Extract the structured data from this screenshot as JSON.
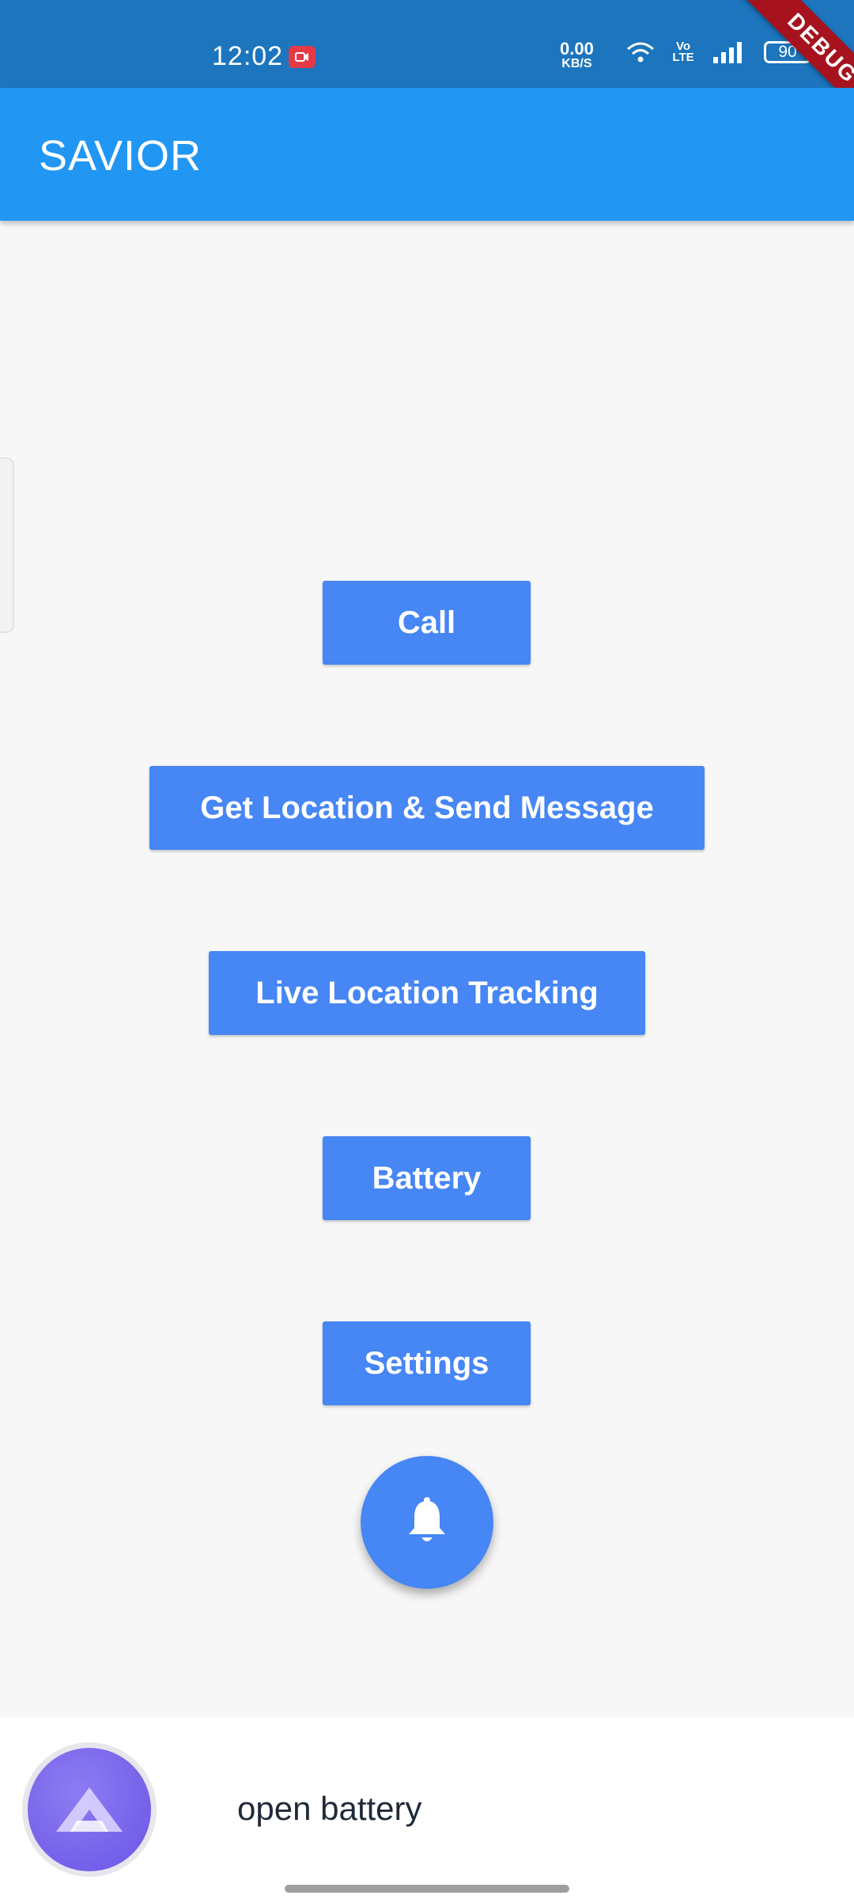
{
  "status_bar": {
    "time": "12:02",
    "net_speed_value": "0.00",
    "net_speed_unit": "KB/S",
    "volte": "Vo LTE",
    "battery": "90"
  },
  "debug_banner": "DEBUG",
  "app_bar": {
    "title": "SAVIOR"
  },
  "buttons": {
    "call": "Call",
    "location": "Get Location & Send Message",
    "tracking": "Live Location Tracking",
    "battery": "Battery",
    "settings": "Settings"
  },
  "fab": {
    "icon": "bell-icon"
  },
  "assistant": {
    "text": "open battery",
    "icon": "assistant-logo-icon"
  },
  "colors": {
    "status_bar": "#1c75bd",
    "app_bar": "#2196f3",
    "button": "#4686f5",
    "debug": "#a6131f"
  }
}
